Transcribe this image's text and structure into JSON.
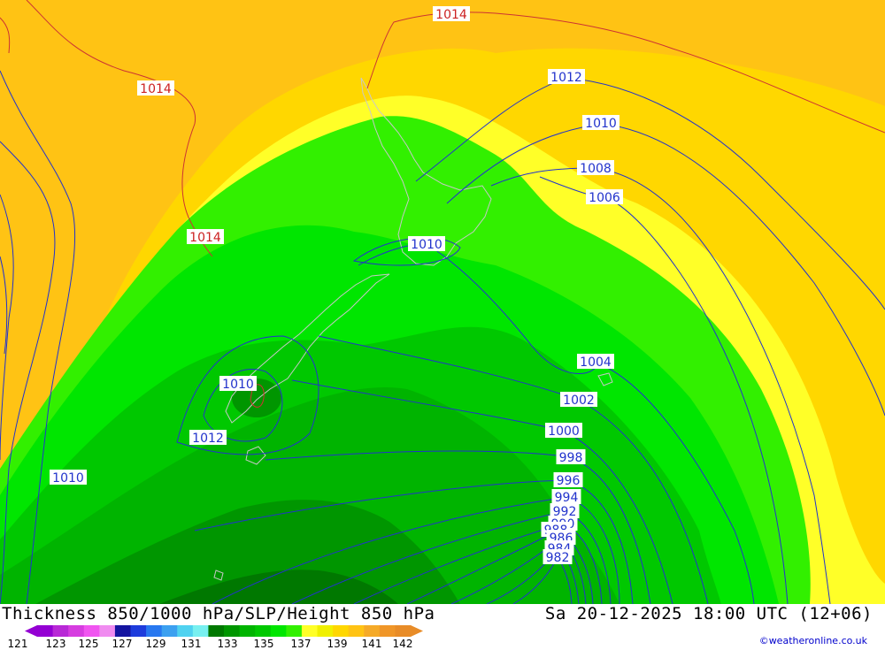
{
  "caption": {
    "title": "Thickness 850/1000 hPa/SLP/Height 850 hPa",
    "datetime": "Sa 20-12-2025 18:00 UTC (12+06)"
  },
  "credit": "©weatheronline.co.uk",
  "legend": {
    "colors": [
      "#9400d3",
      "#b829d6",
      "#d63de0",
      "#f055f0",
      "#f08cf0",
      "#1414a0",
      "#1e3cdc",
      "#2878f0",
      "#3ca0f0",
      "#50d2f0",
      "#78f0f0",
      "#007800",
      "#009600",
      "#00b400",
      "#00c800",
      "#00e600",
      "#32f000",
      "#ffff28",
      "#f0f000",
      "#ffd700",
      "#ffc314",
      "#f5aa28",
      "#f09628",
      "#e88c28"
    ],
    "ticks": [
      "121",
      "123",
      "125",
      "127",
      "129",
      "131",
      "133",
      "135",
      "137",
      "139",
      "141",
      "142"
    ]
  },
  "isobar_labels": [
    {
      "text": "1014",
      "color": "#cc2222"
    },
    {
      "text": "1014",
      "color": "#cc2222"
    },
    {
      "text": "1014",
      "color": "#cc2222"
    },
    {
      "text": "1012",
      "color": "#2233cc"
    },
    {
      "text": "1010",
      "color": "#2233cc"
    },
    {
      "text": "1008",
      "color": "#2233cc"
    },
    {
      "text": "1006",
      "color": "#2233cc"
    },
    {
      "text": "1010",
      "color": "#2233cc"
    },
    {
      "text": "1010",
      "color": "#2233cc"
    },
    {
      "text": "1012",
      "color": "#2233cc"
    },
    {
      "text": "1010",
      "color": "#2233cc"
    },
    {
      "text": "1004",
      "color": "#2233cc"
    },
    {
      "text": "1002",
      "color": "#2233cc"
    },
    {
      "text": "1000",
      "color": "#2233cc"
    },
    {
      "text": "998",
      "color": "#2233cc"
    },
    {
      "text": "996",
      "color": "#2233cc"
    },
    {
      "text": "994",
      "color": "#2233cc"
    },
    {
      "text": "992",
      "color": "#2233cc"
    },
    {
      "text": "990",
      "color": "#2233cc"
    },
    {
      "text": "988",
      "color": "#2233cc"
    },
    {
      "text": "986",
      "color": "#2233cc"
    },
    {
      "text": "984",
      "color": "#2233cc"
    },
    {
      "text": "982",
      "color": "#2233cc"
    }
  ]
}
